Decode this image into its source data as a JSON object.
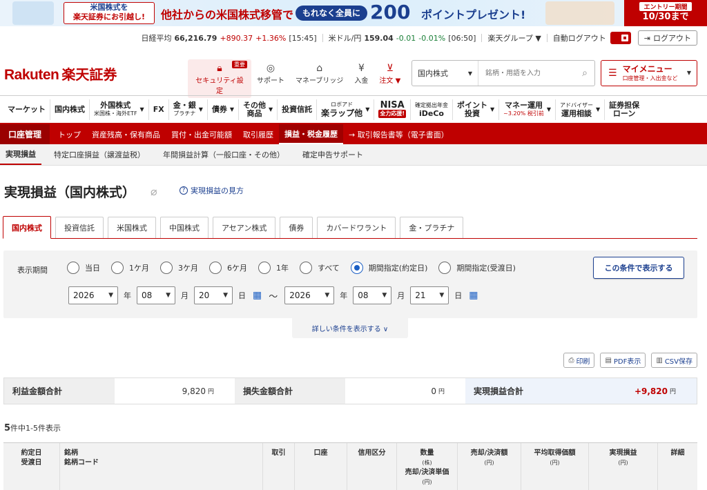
{
  "banner": {
    "line1": "米国株式を",
    "line2": "楽天証券にお引越し!",
    "main": "他社からの米国株式移管で",
    "pill": "もれなく全員に",
    "points": "200",
    "points_text": "ポイントプレゼント!",
    "entry_label": "エントリー期間",
    "entry_date": "10/30まで"
  },
  "ticker": {
    "nikkei_label": "日経平均",
    "nikkei_value": "66,216.79",
    "nikkei_change": "+890.37",
    "nikkei_pct": "+1.36%",
    "nikkei_time": "[15:45]",
    "usdjpy_label": "米ドル/円",
    "usdjpy_value": "159.04",
    "usdjpy_change": "-0.01",
    "usdjpy_pct": "-0.01%",
    "usdjpy_time": "[06:50]",
    "group_label": "楽天グループ ▼",
    "autologout_label": "自動ログアウト",
    "logout_label": "ログアウト"
  },
  "header": {
    "logo_en": "Rakuten",
    "logo_jp": "楽天証券",
    "icons": [
      {
        "label": "セキュリティ設定",
        "badge": "重要"
      },
      {
        "label": "サポート"
      },
      {
        "label": "マネーブリッジ"
      },
      {
        "label": "入金"
      },
      {
        "label": "注文 ▼"
      }
    ],
    "search_select": "国内株式",
    "search_placeholder": "銘柄・用語を入力",
    "mymenu_title": "マイメニュー",
    "mymenu_sub": "口座管理・入出金など"
  },
  "mainnav": [
    {
      "label": "マーケット"
    },
    {
      "label": "国内株式"
    },
    {
      "label": "外国株式",
      "sub": "米国株・海外ETF"
    },
    {
      "label": "FX"
    },
    {
      "label": "金・銀",
      "sub": "プラチナ"
    },
    {
      "label": "債券"
    },
    {
      "label": "その他",
      "sub": "商品"
    },
    {
      "label": "投資信託"
    },
    {
      "label": "ロボアド",
      "sub": "楽ラップ他"
    },
    {
      "label": "NISA",
      "sub": "全力応援!"
    },
    {
      "label": "確定拠出年金",
      "sub": "iDeCo"
    },
    {
      "label": "ポイント",
      "sub": "投資"
    },
    {
      "label": "マネー運用",
      "sub": "~3.20% 税引前"
    },
    {
      "label": "アドバイザー",
      "sub": "運用相談"
    },
    {
      "label": "証券担保",
      "sub": "ローン"
    }
  ],
  "rednav": {
    "account": "口座管理",
    "items": [
      "トップ",
      "資産残高・保有商品",
      "買付・出金可能額",
      "取引履歴",
      "損益・税金履歴",
      "→ 取引報告書等（電子書面）"
    ]
  },
  "graytabs": [
    "実現損益",
    "特定口座損益（譲渡益税）",
    "年間損益計算（一般口座・その他）",
    "確定申告サポート"
  ],
  "page": {
    "title": "実現損益（国内株式）",
    "howto": "実現損益の見方"
  },
  "market_tabs": [
    "国内株式",
    "投資信託",
    "米国株式",
    "中国株式",
    "アセアン株式",
    "債券",
    "カバードワラント",
    "金・プラチナ"
  ],
  "filter": {
    "label": "表示期間",
    "options": [
      "当日",
      "1ケ月",
      "3ケ月",
      "6ケ月",
      "1年",
      "すべて",
      "期間指定(約定日)",
      "期間指定(受渡日)"
    ],
    "selected_index": 6,
    "show_button": "この条件で表示する",
    "from": {
      "year": "2026",
      "month": "08",
      "day": "20"
    },
    "to": {
      "year": "2026",
      "month": "08",
      "day": "21"
    },
    "unit_year": "年",
    "unit_month": "月",
    "unit_day": "日",
    "tilde": "〜",
    "more": "詳しい条件を表示する ∨"
  },
  "exports": [
    "印刷",
    "PDF表示",
    "CSV保存"
  ],
  "summary": {
    "profit_label": "利益金額合計",
    "profit_value": "9,820",
    "loss_label": "損失金額合計",
    "loss_value": "0",
    "total_label": "実現損益合計",
    "total_value": "+9,820",
    "yen": "円"
  },
  "count": {
    "num": "5",
    "text": "件中1-5件表示"
  },
  "table_headers": [
    {
      "l1": "約定日",
      "l2": "受渡日"
    },
    {
      "l1": "銘柄",
      "l2": "銘柄コード"
    },
    {
      "l1": "取引"
    },
    {
      "l1": "口座"
    },
    {
      "l1": "信用区分"
    },
    {
      "l1": "数量",
      "u1": "(株)",
      "l2": "売却/決済単価",
      "u2": "(円)"
    },
    {
      "l1": "売却/決済額",
      "u1": "(円)"
    },
    {
      "l1": "平均取得価額",
      "u1": "(円)"
    },
    {
      "l1": "実現損益",
      "u1": "(円)"
    },
    {
      "l1": "詳細"
    }
  ]
}
